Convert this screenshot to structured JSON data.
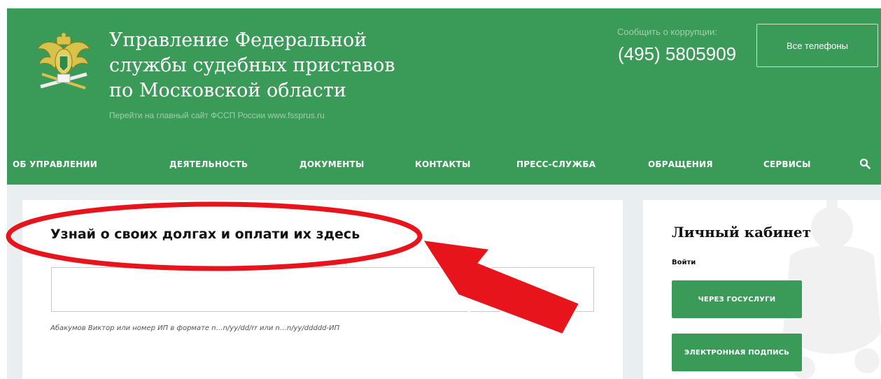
{
  "header": {
    "title": "Управление Федеральной\nслужбы судебных приставов\nпо Московской области",
    "subtitle": "Перейти на главный сайт ФССП России www.fssprus.ru",
    "corruption_label": "Сообщить о коррупции:",
    "corruption_phone": "(495) 5805909",
    "all_phones_label": "Все телефоны"
  },
  "nav": {
    "items": [
      {
        "label": "ОБ УПРАВЛЕНИИ"
      },
      {
        "label": "ДЕЯТЕЛЬНОСТЬ"
      },
      {
        "label": "ДОКУМЕНТЫ"
      },
      {
        "label": "КОНТАКТЫ"
      },
      {
        "label": "ПРЕСС-СЛУЖБА"
      },
      {
        "label": "ОБРАЩЕНИЯ"
      },
      {
        "label": "СЕРВИСЫ"
      }
    ],
    "search_icon": "search-icon"
  },
  "main": {
    "heading": "Узнай о своих долгах и оплати их здесь",
    "search_value": "",
    "search_hint": "Абакумов Виктор или номер ИП в формате n…n/yy/dd/rr или n…n/yy/ddddd-ИП"
  },
  "sidebar": {
    "title": "Личный кабинет",
    "login_label": "Войти",
    "gosuslugi_button": "ЧЕРЕЗ ГОСУСЛУГИ",
    "signature_button": "ЭЛЕКТРОННАЯ ПОДПИСЬ"
  },
  "colors": {
    "brand_green": "#3a9a57",
    "page_bg": "#e9eef0",
    "annotation_red": "#e8141c"
  }
}
